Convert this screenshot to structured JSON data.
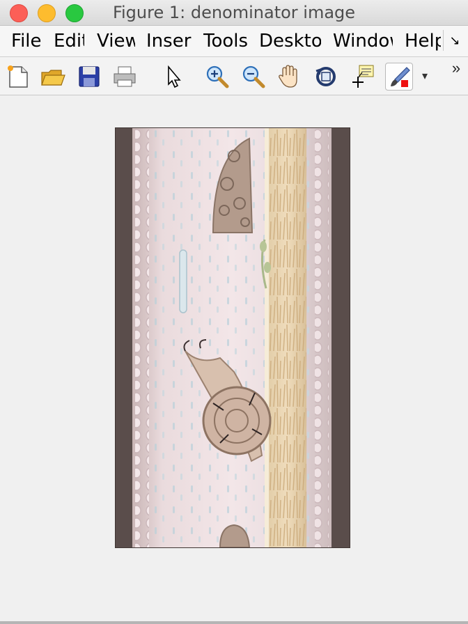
{
  "window": {
    "title": "Figure 1: denominator image"
  },
  "menubar": {
    "items": [
      {
        "label": "File"
      },
      {
        "label": "Edit"
      },
      {
        "label": "View"
      },
      {
        "label": "Insert"
      },
      {
        "label": "Tools"
      },
      {
        "label": "Desktop"
      },
      {
        "label": "Window"
      },
      {
        "label": "Help"
      }
    ],
    "overflow_glyph": "↘"
  },
  "toolbar": {
    "buttons": [
      {
        "name": "new-figure",
        "icon": "new-file-icon"
      },
      {
        "name": "open-file",
        "icon": "open-folder-icon"
      },
      {
        "name": "save-figure",
        "icon": "floppy-disk-icon"
      },
      {
        "name": "print-figure",
        "icon": "printer-icon"
      },
      {
        "name": "edit-plot",
        "icon": "arrow-pointer-icon"
      },
      {
        "name": "zoom-in",
        "icon": "zoom-in-icon"
      },
      {
        "name": "zoom-out",
        "icon": "zoom-out-icon"
      },
      {
        "name": "pan",
        "icon": "hand-icon"
      },
      {
        "name": "rotate-3d",
        "icon": "rotate-3d-icon"
      },
      {
        "name": "data-cursor",
        "icon": "data-cursor-icon"
      },
      {
        "name": "brush",
        "icon": "brush-icon"
      }
    ],
    "overflow_glyph": "»",
    "dropdown_glyph": "▾"
  },
  "colors": {
    "titlebar": "#dcdcdc",
    "background": "#f0f0f0",
    "image_border": "#5c4f4c",
    "image_base": "#efe1e3",
    "wood_stripe": "#e6cfae"
  }
}
